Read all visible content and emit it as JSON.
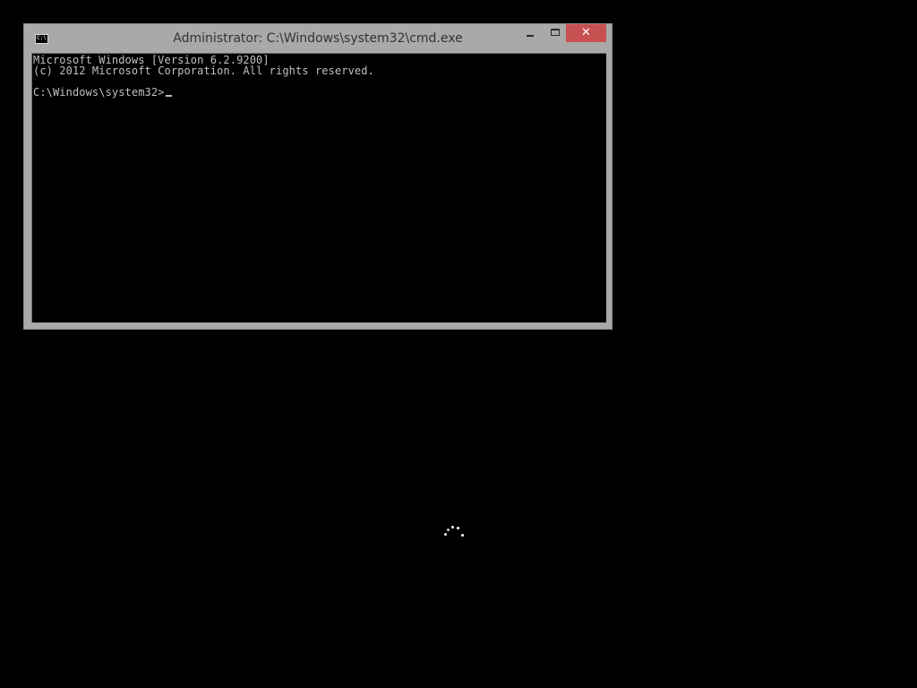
{
  "window": {
    "title": "Administrator: C:\\Windows\\system32\\cmd.exe",
    "icon": "cmd-icon",
    "icon_text": "C:\\.",
    "close_glyph": "✕"
  },
  "console": {
    "lines": [
      "Microsoft Windows [Version 6.2.9200]",
      "(c) 2012 Microsoft Corporation. All rights reserved.",
      "",
      "C:\\Windows\\system32>"
    ]
  },
  "colors": {
    "desktop_background": "#000000",
    "window_frame": "#a9a9a9",
    "close_button": "#c75050",
    "console_text": "#c0c0c0"
  },
  "spinner": {
    "icon": "loading-spinner-icon"
  }
}
